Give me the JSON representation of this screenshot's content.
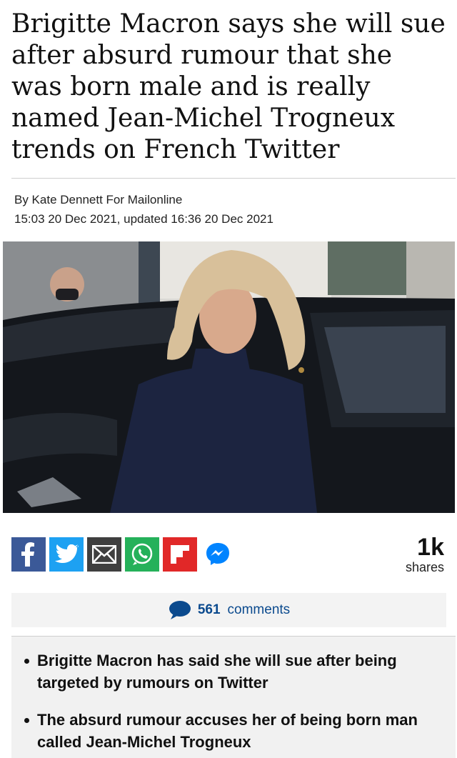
{
  "article": {
    "headline": "Brigitte Macron says she will sue after absurd rumour that she was born male and is really named Jean-Michel Trogneux trends on French Twitter",
    "byline": "By Kate Dennett For Mailonline",
    "dateline": "15:03 20 Dec 2021, updated 16:36 20 Dec 2021"
  },
  "share": {
    "buttons": [
      {
        "name": "facebook",
        "icon": "facebook-icon",
        "color": "#3b5998"
      },
      {
        "name": "twitter",
        "icon": "twitter-icon",
        "color": "#1da1f2"
      },
      {
        "name": "email",
        "icon": "envelope-icon",
        "color": "#3f3f3f"
      },
      {
        "name": "whatsapp",
        "icon": "whatsapp-icon",
        "color": "#25b15a"
      },
      {
        "name": "flipboard",
        "icon": "flipboard-icon",
        "color": "#e12828"
      },
      {
        "name": "messenger",
        "icon": "messenger-icon",
        "color": "#0084ff"
      }
    ],
    "count": "1k",
    "count_label": "shares"
  },
  "comments": {
    "count": "561",
    "label": "comments",
    "color": "#0b4a8e"
  },
  "summary": {
    "bullets": [
      "Brigitte Macron has said she will sue after being targeted by rumours on Twitter",
      "The absurd rumour accuses her of being born man called Jean-Michel Trogneux"
    ]
  }
}
